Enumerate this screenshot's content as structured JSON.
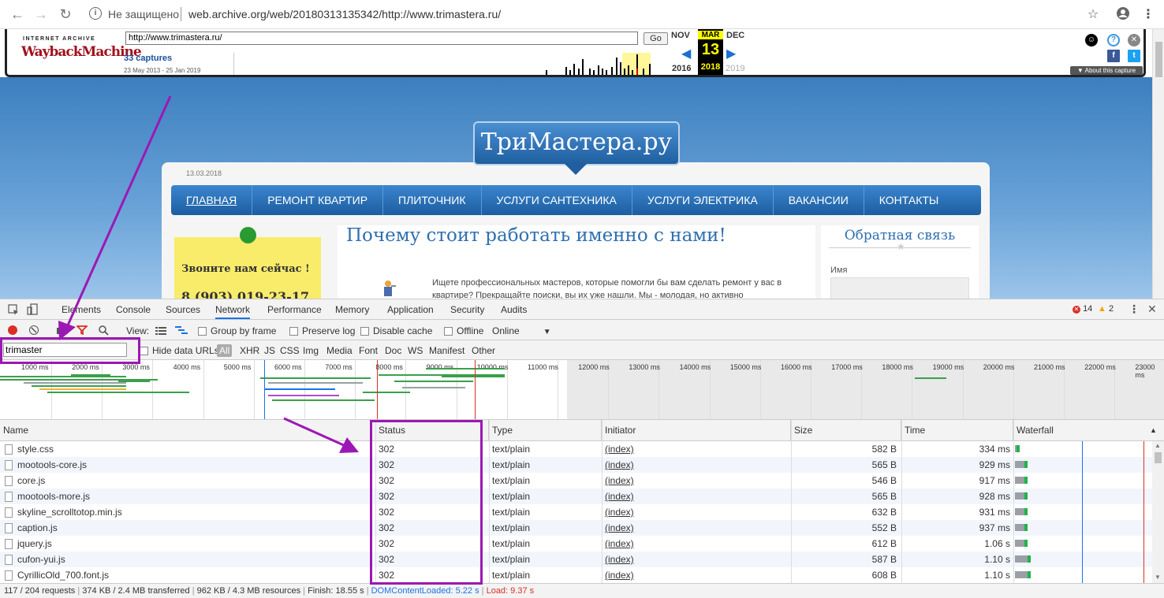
{
  "browser": {
    "insecure_label": "Не защищено",
    "url": "web.archive.org/web/20180313135342/http://www.trimastera.ru/"
  },
  "wayback": {
    "logo_top": "INTERNET ARCHIVE",
    "logo_main": "WaybackMachine",
    "url_value": "http://www.trimastera.ru/",
    "go_label": "Go",
    "captures": "33 captures",
    "range": "23 May 2013 - 25 Jan 2019",
    "prev_month": "NOV",
    "cur_month": "MAR",
    "next_month": "DEC",
    "prev_year": "2016",
    "cur_day": "13",
    "cur_year": "2018",
    "next_year": "2019",
    "about": "▼ About this capture"
  },
  "site": {
    "brand": "ТриМастера.ру",
    "date": "13.03.2018",
    "menu": [
      "ГЛАВНАЯ",
      "РЕМОНТ КВАРТИР",
      "ПЛИТОЧНИК",
      "УСЛУГИ САНТЕХНИКА",
      "УСЛУГИ ЭЛЕКТРИКА",
      "ВАКАНСИИ",
      "КОНТАКТЫ"
    ],
    "sticky_text": "Звоните нам сейчас !",
    "sticky_phone": "8 (903) 019-23-17",
    "heading": "Почему стоит работать именно с нами!",
    "intro": "Ищете профессиональных мастеров, которые помогли бы вам сделать ремонт у вас в квартире? Прекращайте поиски, вы их уже нашли. Мы - молодая, но активно",
    "side_title": "Обратная связь",
    "side_label": "Имя"
  },
  "devtools": {
    "tabs": [
      "Elements",
      "Console",
      "Sources",
      "Network",
      "Performance",
      "Memory",
      "Application",
      "Security",
      "Audits"
    ],
    "active_tab": "Network",
    "errors": "14",
    "warnings": "2",
    "toolbar": {
      "view": "View:",
      "group_by_frame": "Group by frame",
      "preserve_log": "Preserve log",
      "disable_cache": "Disable cache",
      "offline": "Offline",
      "online": "Online"
    },
    "filter": {
      "value": "trimaster",
      "hide_data_urls": "Hide data URLs",
      "types": [
        "All",
        "XHR",
        "JS",
        "CSS",
        "Img",
        "Media",
        "Font",
        "Doc",
        "WS",
        "Manifest",
        "Other"
      ]
    },
    "timeline_labels": [
      "1000 ms",
      "2000 ms",
      "3000 ms",
      "4000 ms",
      "5000 ms",
      "6000 ms",
      "7000 ms",
      "8000 ms",
      "9000 ms",
      "10000 ms",
      "11000 ms",
      "12000 ms",
      "13000 ms",
      "14000 ms",
      "15000 ms",
      "16000 ms",
      "17000 ms",
      "18000 ms",
      "19000 ms",
      "20000 ms",
      "21000 ms",
      "22000 ms",
      "23000 ms"
    ],
    "columns": [
      "Name",
      "Status",
      "Type",
      "Initiator",
      "Size",
      "Time",
      "Waterfall"
    ],
    "rows": [
      {
        "name": "style.css",
        "status": "302",
        "type": "text/plain",
        "initiator": "(index)",
        "size": "582 B",
        "time": "334 ms"
      },
      {
        "name": "mootools-core.js",
        "status": "302",
        "type": "text/plain",
        "initiator": "(index)",
        "size": "565 B",
        "time": "929 ms"
      },
      {
        "name": "core.js",
        "status": "302",
        "type": "text/plain",
        "initiator": "(index)",
        "size": "546 B",
        "time": "917 ms"
      },
      {
        "name": "mootools-more.js",
        "status": "302",
        "type": "text/plain",
        "initiator": "(index)",
        "size": "565 B",
        "time": "928 ms"
      },
      {
        "name": "skyline_scrolltotop.min.js",
        "status": "302",
        "type": "text/plain",
        "initiator": "(index)",
        "size": "632 B",
        "time": "931 ms"
      },
      {
        "name": "caption.js",
        "status": "302",
        "type": "text/plain",
        "initiator": "(index)",
        "size": "552 B",
        "time": "937 ms"
      },
      {
        "name": "jquery.js",
        "status": "302",
        "type": "text/plain",
        "initiator": "(index)",
        "size": "612 B",
        "time": "1.06 s"
      },
      {
        "name": "cufon-yui.js",
        "status": "302",
        "type": "text/plain",
        "initiator": "(index)",
        "size": "587 B",
        "time": "1.10 s"
      },
      {
        "name": "CyrillicOld_700.font.js",
        "status": "302",
        "type": "text/plain",
        "initiator": "(index)",
        "size": "608 B",
        "time": "1.10 s"
      }
    ],
    "status_bar": {
      "requests": "117 / 204 requests",
      "transferred": "374 KB / 2.4 MB transferred",
      "resources": "962 KB / 4.3 MB resources",
      "finish": "Finish: 18.55 s",
      "dcl": "DOMContentLoaded: 5.22 s",
      "load": "Load: 9.37 s"
    }
  },
  "colors": {
    "annotation": "#9c18b4",
    "dcl": "#1a73e8",
    "load": "#d93025"
  }
}
